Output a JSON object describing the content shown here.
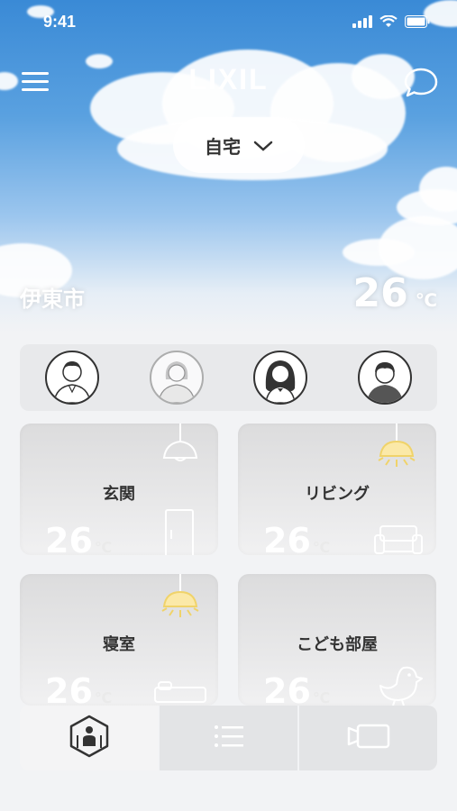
{
  "status": {
    "time": "9:41"
  },
  "header": {
    "logo": "LIXIL",
    "home_selector": "自宅"
  },
  "weather": {
    "city": "伊東市",
    "temperature": "26",
    "unit": "℃"
  },
  "members": [
    "member-1",
    "member-2",
    "member-3",
    "member-4"
  ],
  "rooms": [
    {
      "name": "玄関",
      "temperature": "26",
      "unit": "℃",
      "light": "off"
    },
    {
      "name": "リビング",
      "temperature": "26",
      "unit": "℃",
      "light": "on"
    },
    {
      "name": "寝室",
      "temperature": "26",
      "unit": "℃",
      "light": "on"
    },
    {
      "name": "こども部屋",
      "temperature": "26",
      "unit": "℃",
      "light": "none"
    }
  ],
  "colors": {
    "light_on": "#f0d36a",
    "sky": "#3a8ad6"
  },
  "bottom_nav": [
    "house-view",
    "list-view",
    "camera-view"
  ]
}
